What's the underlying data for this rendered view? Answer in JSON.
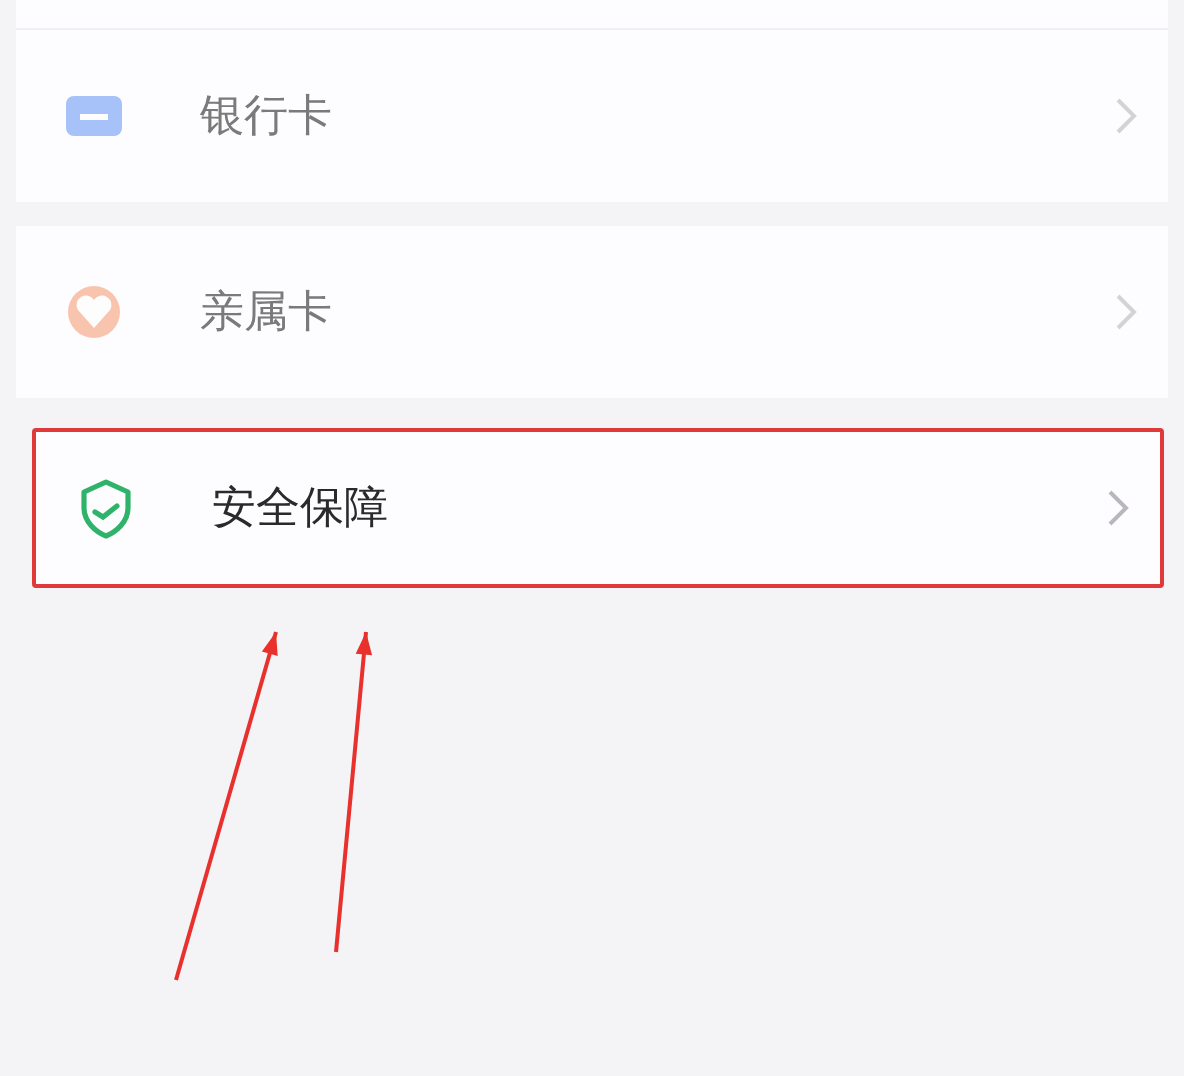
{
  "menu_items": [
    {
      "kind": "card",
      "label": "银行卡",
      "blurred": true,
      "highlighted": false
    },
    {
      "kind": "family",
      "label": "亲属卡",
      "blurred": true,
      "highlighted": false
    },
    {
      "kind": "shield",
      "label": "安全保障",
      "blurred": false,
      "highlighted": true
    }
  ],
  "annotations": [
    {
      "kind": "arrow"
    },
    {
      "kind": "arrow"
    }
  ]
}
